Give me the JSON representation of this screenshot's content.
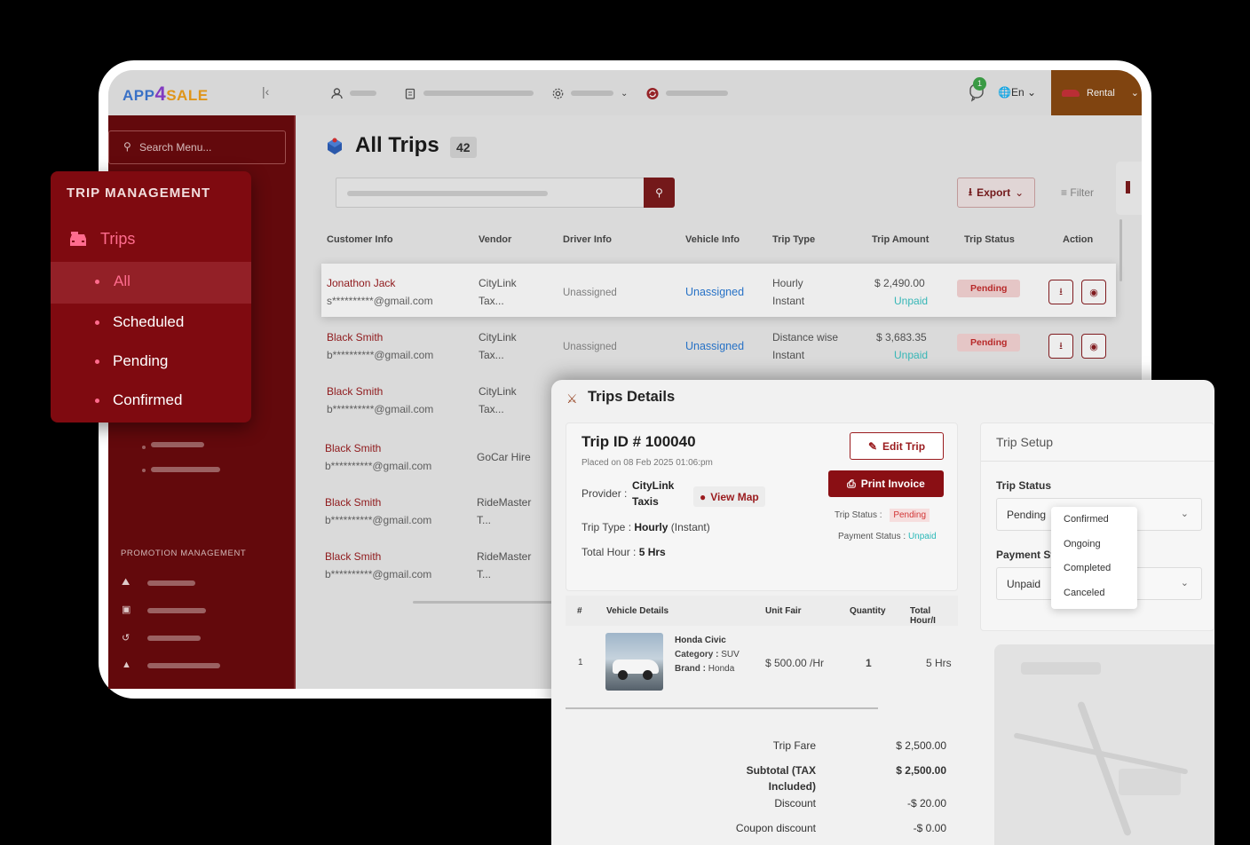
{
  "app": {
    "logo": {
      "part1": "APP",
      "part2": "4",
      "part3": "SALE"
    },
    "rental_label": "Rental",
    "language": "En",
    "notifications": "1"
  },
  "sidebar": {
    "search_placeholder": "Search Menu...",
    "promotion_label": "PROMOTION MANAGEMENT"
  },
  "trip_menu": {
    "header": "TRIP MANAGEMENT",
    "main_item": "Trips",
    "items": [
      {
        "label": "All",
        "selected": true
      },
      {
        "label": "Scheduled",
        "selected": false
      },
      {
        "label": "Pending",
        "selected": false
      },
      {
        "label": "Confirmed",
        "selected": false
      }
    ]
  },
  "page": {
    "title": "All Trips",
    "count": "42",
    "export_label": "Export",
    "filter_label": "Filter"
  },
  "table": {
    "headers": [
      "Customer Info",
      "Vendor",
      "Driver Info",
      "Vehicle Info",
      "Trip Type",
      "Trip Amount",
      "Trip Status",
      "Action"
    ],
    "rows": [
      {
        "name": "Jonathon Jack",
        "email": "s**********@gmail.com",
        "vendor1": "CityLink",
        "vendor2": "Tax...",
        "driver": "Unassigned",
        "vehicle": "Unassigned",
        "type1": "Hourly",
        "type2": "Instant",
        "amount": "$ 2,490.00",
        "payment": "Unpaid",
        "status": "Pending"
      },
      {
        "name": "Black Smith",
        "email": "b**********@gmail.com",
        "vendor1": "CityLink",
        "vendor2": "Tax...",
        "driver": "Unassigned",
        "vehicle": "Unassigned",
        "type1": "Distance wise",
        "type2": "Instant",
        "amount": "$ 3,683.35",
        "payment": "Unpaid",
        "status": "Pending"
      },
      {
        "name": "Black Smith",
        "email": "b**********@gmail.com",
        "vendor1": "CityLink",
        "vendor2": "Tax..."
      },
      {
        "name": "Black Smith",
        "email": "b**********@gmail.com",
        "vendor1": "GoCar Hire",
        "vendor2": ""
      },
      {
        "name": "Black Smith",
        "email": "b**********@gmail.com",
        "vendor1": "RideMaster",
        "vendor2": "T..."
      },
      {
        "name": "Black Smith",
        "email": "b**********@gmail.com",
        "vendor1": "RideMaster",
        "vendor2": "T..."
      }
    ]
  },
  "details": {
    "title": "Trips Details",
    "trip_id": "Trip ID # 100040",
    "placed": "Placed on 08 Feb 2025 01:06:pm",
    "edit_label": "Edit Trip",
    "print_label": "Print Invoice",
    "provider_label": "Provider :",
    "provider_1": "CityLink",
    "provider_2": "Taxis",
    "view_map": "View Map",
    "trip_type_label": "Trip Type :",
    "trip_type_value": "Hourly",
    "trip_type_extra": "(Instant)",
    "total_hour_label": "Total Hour :",
    "total_hour_value": "5 Hrs",
    "trip_status_label": "Trip Status :",
    "trip_status_value": "Pending",
    "payment_status_label": "Payment Status :",
    "payment_status_value": "Unpaid",
    "vehicle_table": {
      "headers": [
        "#",
        "Vehicle Details",
        "Unit Fair",
        "Quantity",
        "Total Hour/I"
      ],
      "row": {
        "num": "1",
        "name": "Honda Civic",
        "category_label": "Category :",
        "category": "SUV",
        "brand_label": "Brand :",
        "brand": "Honda",
        "unit": "$ 500.00 /Hr",
        "qty": "1",
        "hours": "5 Hrs"
      }
    },
    "summary": [
      {
        "label": "Trip Fare",
        "value": "$ 2,500.00"
      },
      {
        "label": "Subtotal (TAX",
        "label2": "Included)",
        "value": "$ 2,500.00"
      },
      {
        "label": "Discount",
        "value": "-$ 20.00"
      },
      {
        "label": "Coupon discount",
        "value": "-$ 0.00"
      }
    ]
  },
  "setup": {
    "title": "Trip Setup",
    "trip_status_label": "Trip Status",
    "trip_status_value": "Pending",
    "payment_label": "Payment St",
    "payment_value": "Unpaid",
    "dropdown": [
      "Confirmed",
      "Ongoing",
      "Completed",
      "Canceled"
    ]
  },
  "colors": {
    "brand": "#7d1b1d",
    "sidebar": "#6b0a0d",
    "pending": "#c62d2d",
    "unpaid": "#3cc5c5",
    "link": "#2b7bd6"
  }
}
